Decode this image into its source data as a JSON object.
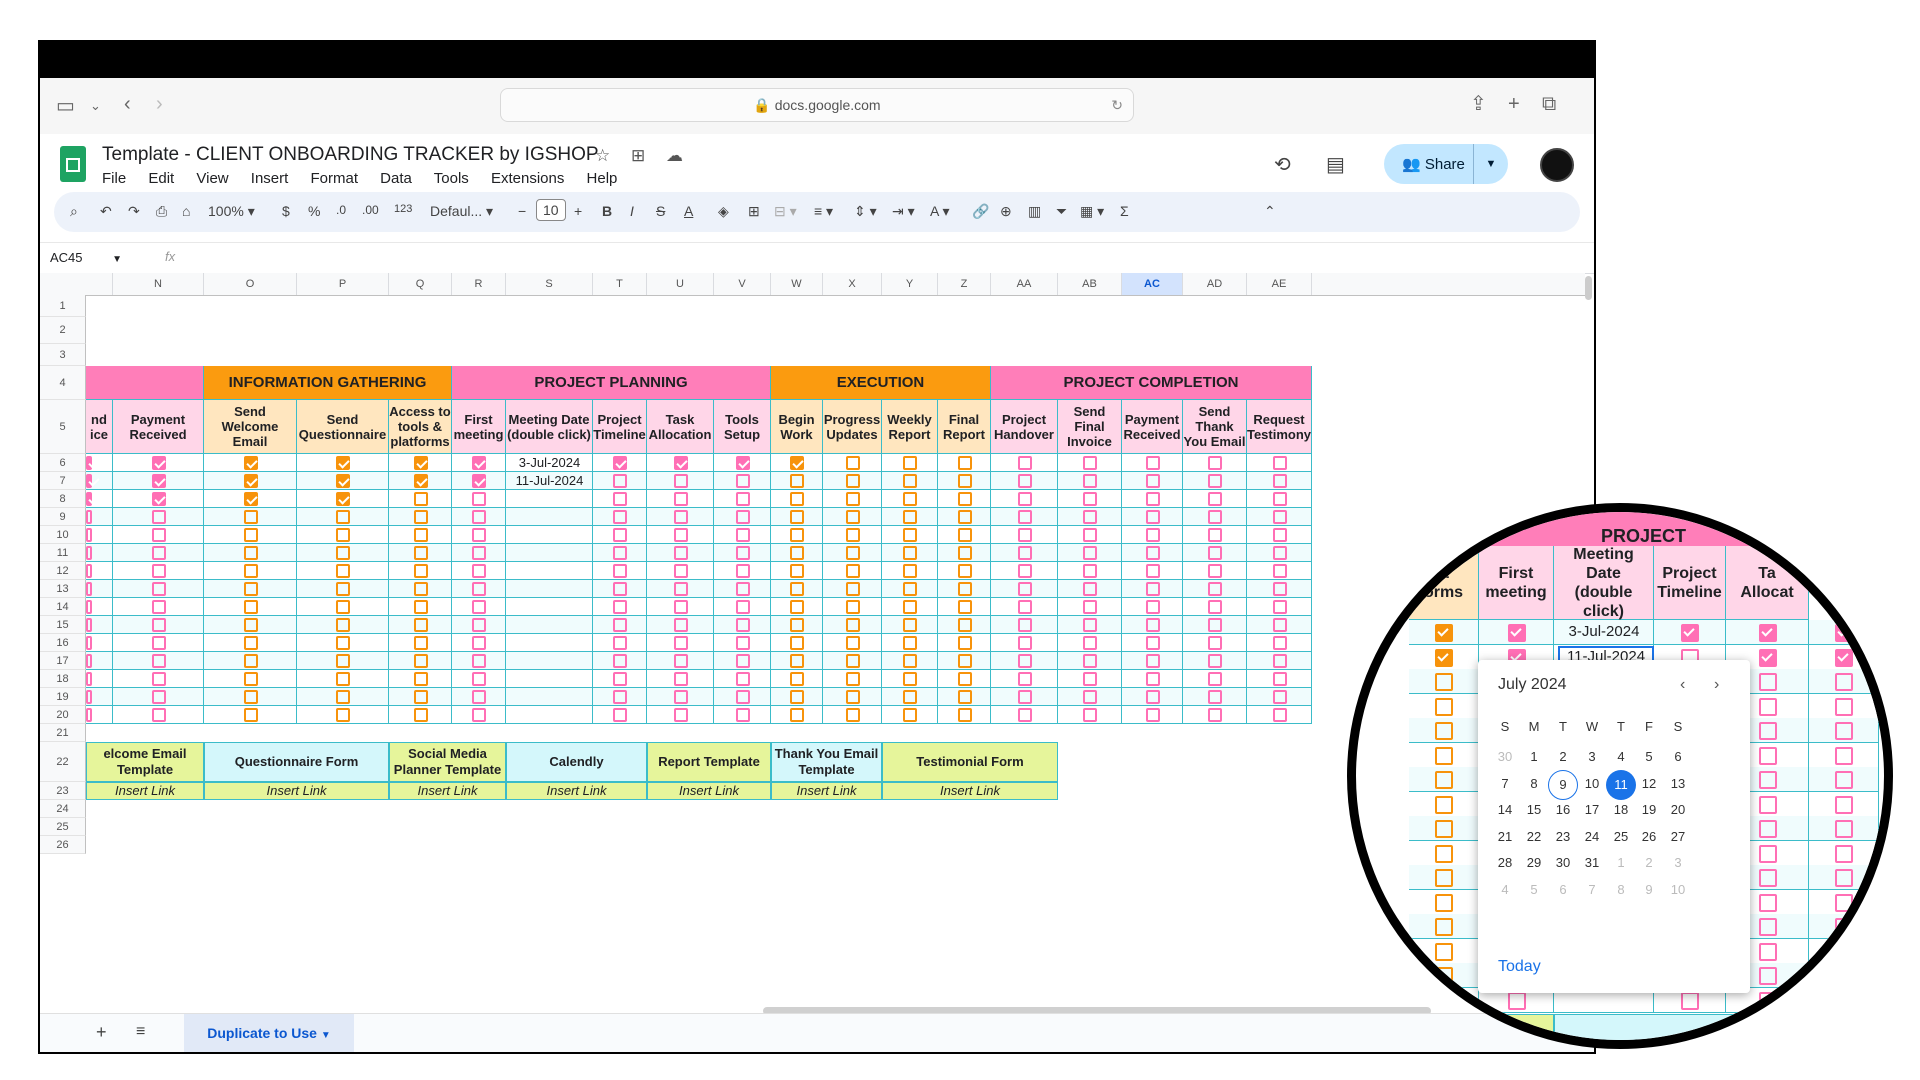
{
  "browser": {
    "url": "docs.google.com"
  },
  "app": {
    "doc_title": "Template - CLIENT ONBOARDING TRACKER by IGSHOP",
    "menu": [
      "File",
      "Edit",
      "View",
      "Insert",
      "Format",
      "Data",
      "Tools",
      "Extensions",
      "Help"
    ],
    "share_label": "Share"
  },
  "toolbar": {
    "zoom": "100%",
    "currency": "$",
    "percent": "%",
    "dec_less": ".0",
    "dec_more": ".00",
    "format_num": "123",
    "font": "Defaul...",
    "font_size": "10"
  },
  "formula_bar": {
    "cell_ref": "AC45",
    "fx": "fx"
  },
  "columns": [
    "N",
    "O",
    "P",
    "Q",
    "R",
    "S",
    "T",
    "U",
    "V",
    "W",
    "X",
    "Y",
    "Z",
    "AA",
    "AB",
    "AC",
    "AD",
    "AE"
  ],
  "selected_column": "AC",
  "rows": [
    "1",
    "2",
    "3",
    "4",
    "5",
    "6",
    "7",
    "8",
    "9",
    "10",
    "11",
    "12",
    "13",
    "14",
    "15",
    "16",
    "17",
    "18",
    "19",
    "20",
    "21",
    "22",
    "23",
    "24",
    "25",
    "26"
  ],
  "sections": [
    {
      "label": "",
      "color": "#ff7eb9"
    },
    {
      "label": "INFORMATION GATHERING",
      "color": "#fb9b0f"
    },
    {
      "label": "PROJECT PLANNING",
      "color": "#ff7eb9"
    },
    {
      "label": "EXECUTION",
      "color": "#fb9b0f"
    },
    {
      "label": "PROJECT COMPLETION",
      "color": "#ff7eb9"
    }
  ],
  "subheaders": [
    "nd\nice",
    "Payment\nReceived",
    "Send Welcome\nEmail",
    "Send\nQuestionnaire",
    "Access to\ntools &\nplatforms",
    "First\nmeeting",
    "Meeting Date\n(double click)",
    "Project\nTimeline",
    "Task\nAllocation",
    "Tools\nSetup",
    "Begin\nWork",
    "Progress\nUpdates",
    "Weekly\nReport",
    "Final\nReport",
    "Project\nHandover",
    "Send\nFinal\nInvoice",
    "Payment\nReceived",
    "Send\nThank\nYou Email",
    "Request\nTestimony"
  ],
  "dates": {
    "row6": "3-Jul-2024",
    "row7": "11-Jul-2024"
  },
  "checked": {
    "N": [
      6,
      7,
      8
    ],
    "O": [
      6,
      7,
      8
    ],
    "P": [
      6,
      7,
      8
    ],
    "Q": [
      6,
      7
    ],
    "R": [
      6,
      7
    ],
    "T": [
      6
    ],
    "U": [
      6
    ],
    "V": [
      6
    ],
    "W": [
      6
    ]
  },
  "resources": [
    {
      "label": "elcome Email\nTemplate",
      "link": "Insert Link",
      "color": "#e6f59b"
    },
    {
      "label": "Questionnaire Form",
      "link": "Insert Link",
      "color": "#d4f7fb"
    },
    {
      "label": "Social Media\nPlanner Template",
      "link": "Insert Link",
      "color": "#e6f59b"
    },
    {
      "label": "Calendly",
      "link": "Insert Link",
      "color": "#d4f7fb"
    },
    {
      "label": "Report Template",
      "link": "Insert Link",
      "color": "#e6f59b"
    },
    {
      "label": "Thank You Email\nTemplate",
      "link": "Insert Link",
      "color": "#d4f7fb"
    },
    {
      "label": "Testimonial Form",
      "link": "Insert Link",
      "color": "#e6f59b"
    }
  ],
  "sheet_tab": "Duplicate to Use",
  "zoom_view": {
    "band_label": "PROJECT",
    "headers": [
      "&\norms",
      "First\nmeeting",
      "Meeting Date\n(double click)",
      "Project\nTimeline",
      "Ta\nAllocat"
    ],
    "date1": "3-Jul-2024",
    "date2": "11-Jul-2024",
    "bottom_label": "Calendly"
  },
  "calendar": {
    "month": "July 2024",
    "weekdays": [
      "S",
      "M",
      "T",
      "W",
      "T",
      "F",
      "S"
    ],
    "weeks": [
      [
        "30",
        "1",
        "2",
        "3",
        "4",
        "5",
        "6"
      ],
      [
        "7",
        "8",
        "9",
        "10",
        "11",
        "12",
        "13"
      ],
      [
        "14",
        "15",
        "16",
        "17",
        "18",
        "19",
        "20"
      ],
      [
        "21",
        "22",
        "23",
        "24",
        "25",
        "26",
        "27"
      ],
      [
        "28",
        "29",
        "30",
        "31",
        "1",
        "2",
        "3"
      ],
      [
        "4",
        "5",
        "6",
        "7",
        "8",
        "9",
        "10"
      ]
    ],
    "today": "9",
    "selected": "11",
    "today_label": "Today"
  }
}
